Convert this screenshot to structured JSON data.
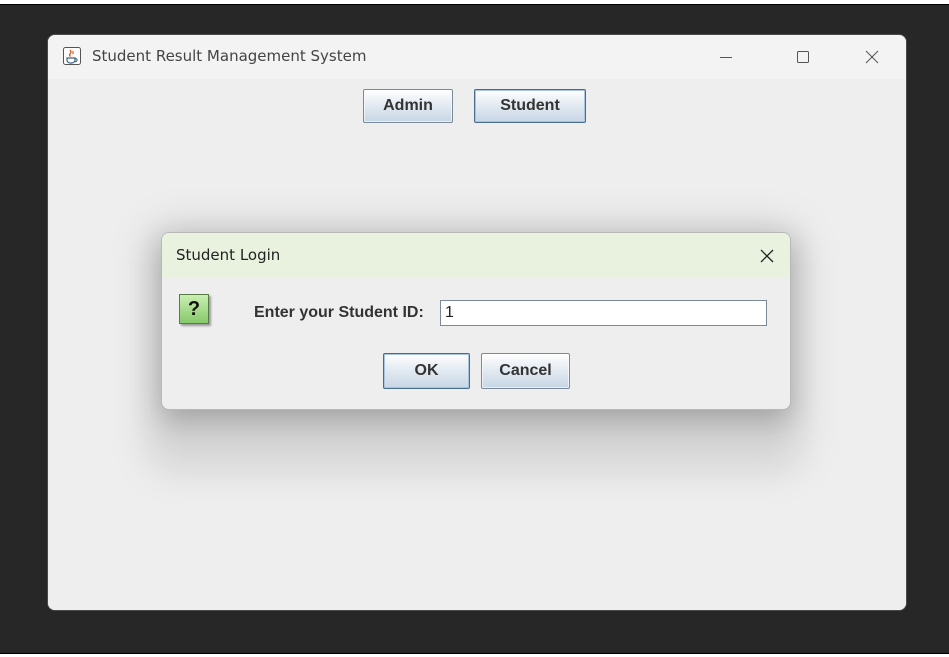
{
  "window": {
    "title": "Student Result Management System",
    "icon": "java-cup-icon",
    "controls": {
      "minimize": "minimize-icon",
      "maximize": "maximize-icon",
      "close": "close-icon"
    }
  },
  "toolbar": {
    "admin_label": "Admin",
    "student_label": "Student"
  },
  "dialog": {
    "title": "Student Login",
    "close_icon": "close-icon",
    "icon": "question-icon",
    "icon_glyph": "?",
    "prompt": "Enter your Student ID:",
    "input_value": "1",
    "ok_label": "OK",
    "cancel_label": "Cancel"
  },
  "colors": {
    "backdrop": "#272727",
    "window_bg": "#eeeeee",
    "dialog_title_bg": "#e8f2de",
    "button_border": "#7a8a99",
    "question_icon_green": "#86c96b"
  }
}
